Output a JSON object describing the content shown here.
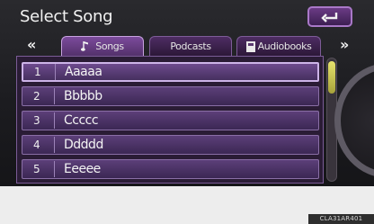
{
  "header": {
    "title": "Select Song"
  },
  "nav": {
    "prev": "«",
    "next": "»"
  },
  "tabs": [
    {
      "label": "Songs",
      "icon": "music-note-icon",
      "active": true
    },
    {
      "label": "Podcasts",
      "icon": "",
      "active": false
    },
    {
      "label": "Audiobooks",
      "icon": "book-icon",
      "active": false
    }
  ],
  "songs": [
    {
      "number": "1",
      "title": "Aaaaa",
      "selected": true
    },
    {
      "number": "2",
      "title": "Bbbbb",
      "selected": false
    },
    {
      "number": "3",
      "title": "Ccccc",
      "selected": false
    },
    {
      "number": "4",
      "title": "Ddddd",
      "selected": false
    },
    {
      "number": "5",
      "title": "Eeeee",
      "selected": false
    }
  ],
  "footer": {
    "caption": "CLA31AR401"
  },
  "colors": {
    "accent": "#6a3b85",
    "scroll_thumb": "#d9d35a"
  }
}
